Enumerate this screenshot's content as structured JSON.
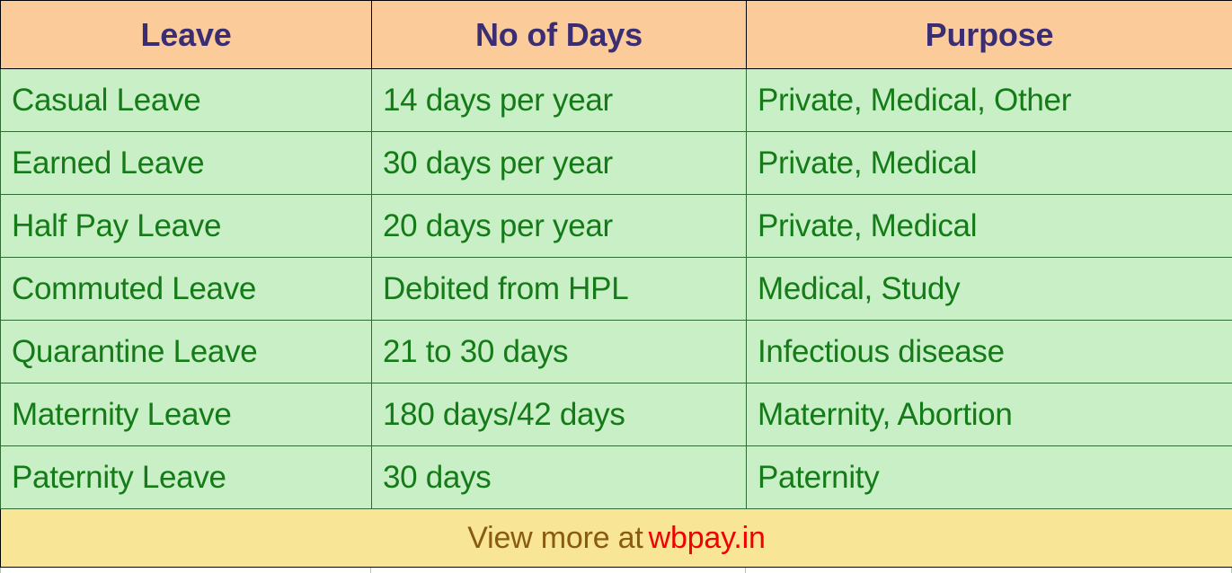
{
  "table": {
    "columns": [
      "Leave",
      "No of Days",
      "Purpose"
    ],
    "rows": [
      [
        "Casual Leave",
        "14 days per year",
        "Private, Medical, Other"
      ],
      [
        "Earned Leave",
        "30 days per year",
        "Private, Medical"
      ],
      [
        "Half Pay Leave",
        "20 days per year",
        "Private, Medical"
      ],
      [
        "Commuted Leave",
        "Debited from HPL",
        "Medical, Study"
      ],
      [
        "Quarantine Leave",
        "21 to 30 days",
        "Infectious disease"
      ],
      [
        "Maternity Leave",
        "180 days/42 days",
        "Maternity, Abortion"
      ],
      [
        "Paternity Leave",
        "30 days",
        "Paternity"
      ]
    ]
  },
  "footer": {
    "lead_text": "View more at",
    "site_text": "wbpay.in"
  },
  "colors": {
    "header_bg": "#FBCC9A",
    "header_text": "#3B2D72",
    "row_bg": "#C8EFC5",
    "row_text": "#157A18",
    "footer_bg": "#F8E596",
    "footer_lead_text": "#8A5A10",
    "footer_site_text": "#F20000",
    "grid_line": "#000000"
  }
}
